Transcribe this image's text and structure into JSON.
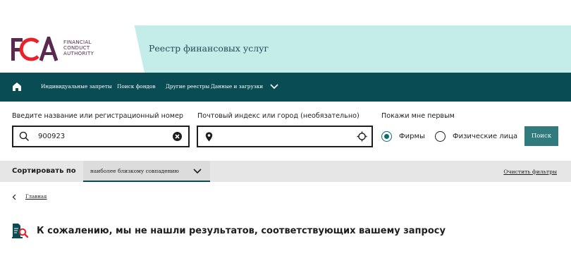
{
  "header": {
    "logo_letters": "FCA",
    "logo_line1": "FINANCIAL",
    "logo_line2": "CONDUCT",
    "logo_line3": "AUTHORITY",
    "title": "Реестр финансовых услуг"
  },
  "nav": {
    "items": [
      {
        "label": "Индивидуальные запреты"
      },
      {
        "label": "Поиск фондов"
      },
      {
        "label": "Другие реестры"
      },
      {
        "label": "Данные и загрузки"
      }
    ]
  },
  "search": {
    "name_label": "Введите название или регистрационный номер",
    "name_value": "900923",
    "postcode_label": "Почтовый индекс или город (необязательно)",
    "postcode_value": "",
    "show_first_label": "Покажи мне первым",
    "option_firms": "Фирмы",
    "option_people": "Физические лица",
    "selected_option": "Фирмы",
    "button_label": "Поиск"
  },
  "sort": {
    "label": "Сортировать по",
    "value": "наиболее близкому совпадению",
    "clear_filters": "Очистить фильтры"
  },
  "breadcrumb": {
    "home": "Главная"
  },
  "results": {
    "no_results_message": "К сожалению, мы не нашли результатов, соответствующих вашему запросу"
  },
  "colors": {
    "nav_bg": "#0a4c54",
    "header_tint": "#c4ece9",
    "button_bg": "#317a7e",
    "brand_red": "#e8212a",
    "brand_purple": "#5a2a4e"
  },
  "icons": {
    "nav_home": "home-icon",
    "search": "search-icon",
    "clear": "clear-circle-icon",
    "location": "location-pin-icon",
    "locate": "crosshair-icon",
    "chevron": "chevron-down-icon",
    "back": "chevron-left-icon",
    "no_results": "document-search-icon"
  }
}
